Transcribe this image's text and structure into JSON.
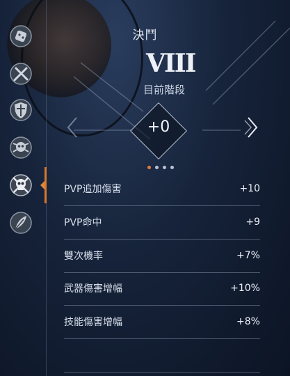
{
  "header": {
    "title": "決鬥",
    "rank_numeral": "VIII",
    "rank_label": "目前階段",
    "level_value": "+0"
  },
  "sidebar": {
    "items": [
      {
        "icon": "dice-icon",
        "active": false
      },
      {
        "icon": "crossed-swords-icon",
        "active": false
      },
      {
        "icon": "shield-icon",
        "active": false
      },
      {
        "icon": "skull-emblem-icon",
        "active": false
      },
      {
        "icon": "skull-crossbones-icon",
        "active": true
      },
      {
        "icon": "feather-icon",
        "active": false
      }
    ]
  },
  "pagination": {
    "count": 4,
    "active_index": 0
  },
  "stats": [
    {
      "label": "PVP追加傷害",
      "value": "+10"
    },
    {
      "label": "PVP命中",
      "value": "+9"
    },
    {
      "label": "雙次機率",
      "value": "+7%"
    },
    {
      "label": "武器傷害增幅",
      "value": "+10%"
    },
    {
      "label": "技能傷害增幅",
      "value": "+8%"
    }
  ],
  "colors": {
    "accent": "#e0803a",
    "text": "#dfe6f0",
    "divider": "#8a98b0"
  }
}
